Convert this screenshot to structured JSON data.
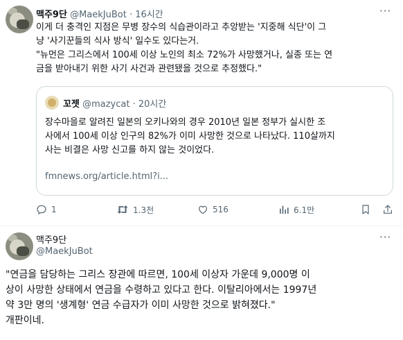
{
  "tweet1": {
    "author_name": "맥주9단",
    "author_handle": "@MaekJuBot",
    "time": "· 16시간",
    "more": "···",
    "lines": [
      "이게 더 충격인 지점은 무병 장수의 식습관이라고 추앙받는 '지중해 식단'이 그",
      "냥 '사기꾼들의 식사 방식' 일수도 있다는거.",
      "\"뉴먼은 그리스에서 100세 이상 노인의 최소 72%가 사망했거나, 실종 또는 연",
      "금을 받아내기 위한 사기 사건과 관련됐을 것으로 추정했다.\""
    ],
    "quote": {
      "author_name": "꼬젯",
      "author_handle": "@mazycat",
      "time": "· 20시간",
      "lines": [
        "장수마을로 알려진 일본의 오키나와의 경우 2010년 일본 정부가 실시한 조",
        "사에서 100세 이상 인구의 82%가 이미 사망한 것으로 나타났다. 110살까지",
        "사는 비결은 사망 신고를 하지 않는 것이었다."
      ],
      "link": "fmnews.org/article.html?i..."
    },
    "actions": {
      "reply_count": "1",
      "retweet_count": "1.3천",
      "like_count": "516",
      "view_count": "6.1만"
    }
  },
  "tweet2": {
    "author_name": "맥주9단",
    "author_handle": "@MaekJuBot",
    "more": "···",
    "lines": [
      "\"연금을 담당하는 그리스 장관에 따르면, 100세 이상자 가운데 9,000명 이",
      "상이 사망한 상태에서 연금을 수령하고 있다고 한다. 이탈리아에서는 1997년",
      "약 3만 명의 '생계형' 연금 수급자가 이미 사망한 것으로 밝혀졌다.\"",
      "개판이네."
    ]
  }
}
